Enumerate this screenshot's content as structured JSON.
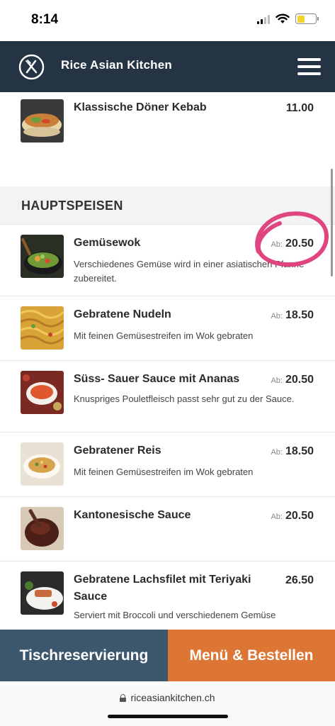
{
  "status": {
    "time": "8:14"
  },
  "header": {
    "title": "Rice Asian Kitchen",
    "logo_icon": "fork-knife-logo-icon",
    "menu_icon": "hamburger-menu-icon"
  },
  "top_item": {
    "name": "Klassische Döner Kebab",
    "price": "11.00"
  },
  "section": {
    "title": "HAUPTSPEISEN"
  },
  "items": [
    {
      "name": "Gemüsewok",
      "from": "Ab:",
      "price": "20.50",
      "description": "Verschiedenes Gemüse wird in einer asiatischen Pfanne zubereitet."
    },
    {
      "name": "Gebratene Nudeln",
      "from": "Ab:",
      "price": "18.50",
      "description": "Mit feinen Gemüsestreifen im Wok gebraten"
    },
    {
      "name": "Süss- Sauer Sauce mit Ananas",
      "from": "Ab:",
      "price": "20.50",
      "description": "Knuspriges Pouletfleisch passt sehr gut zu der Sauce."
    },
    {
      "name": "Gebratener Reis",
      "from": "Ab:",
      "price": "18.50",
      "description": "Mit feinen Gemüsestreifen im Wok gebraten"
    },
    {
      "name": "Kantonesische Sauce",
      "from": "Ab:",
      "price": "20.50",
      "description": ""
    },
    {
      "name": "Gebratene Lachsfilet mit Teriyaki Sauce",
      "from": "",
      "price": "26.50",
      "description": "Serviert mit Broccoli und verschiedenem Gemüse"
    }
  ],
  "buttons": {
    "reserve": "Tischreservierung",
    "order": "Menü & Bestellen"
  },
  "browser": {
    "url": "riceasiankitchen.ch"
  },
  "colors": {
    "header": "#243444",
    "reserve_button": "#3c566e",
    "order_button": "#dd7634",
    "highlight_circle": "#e0457f"
  }
}
